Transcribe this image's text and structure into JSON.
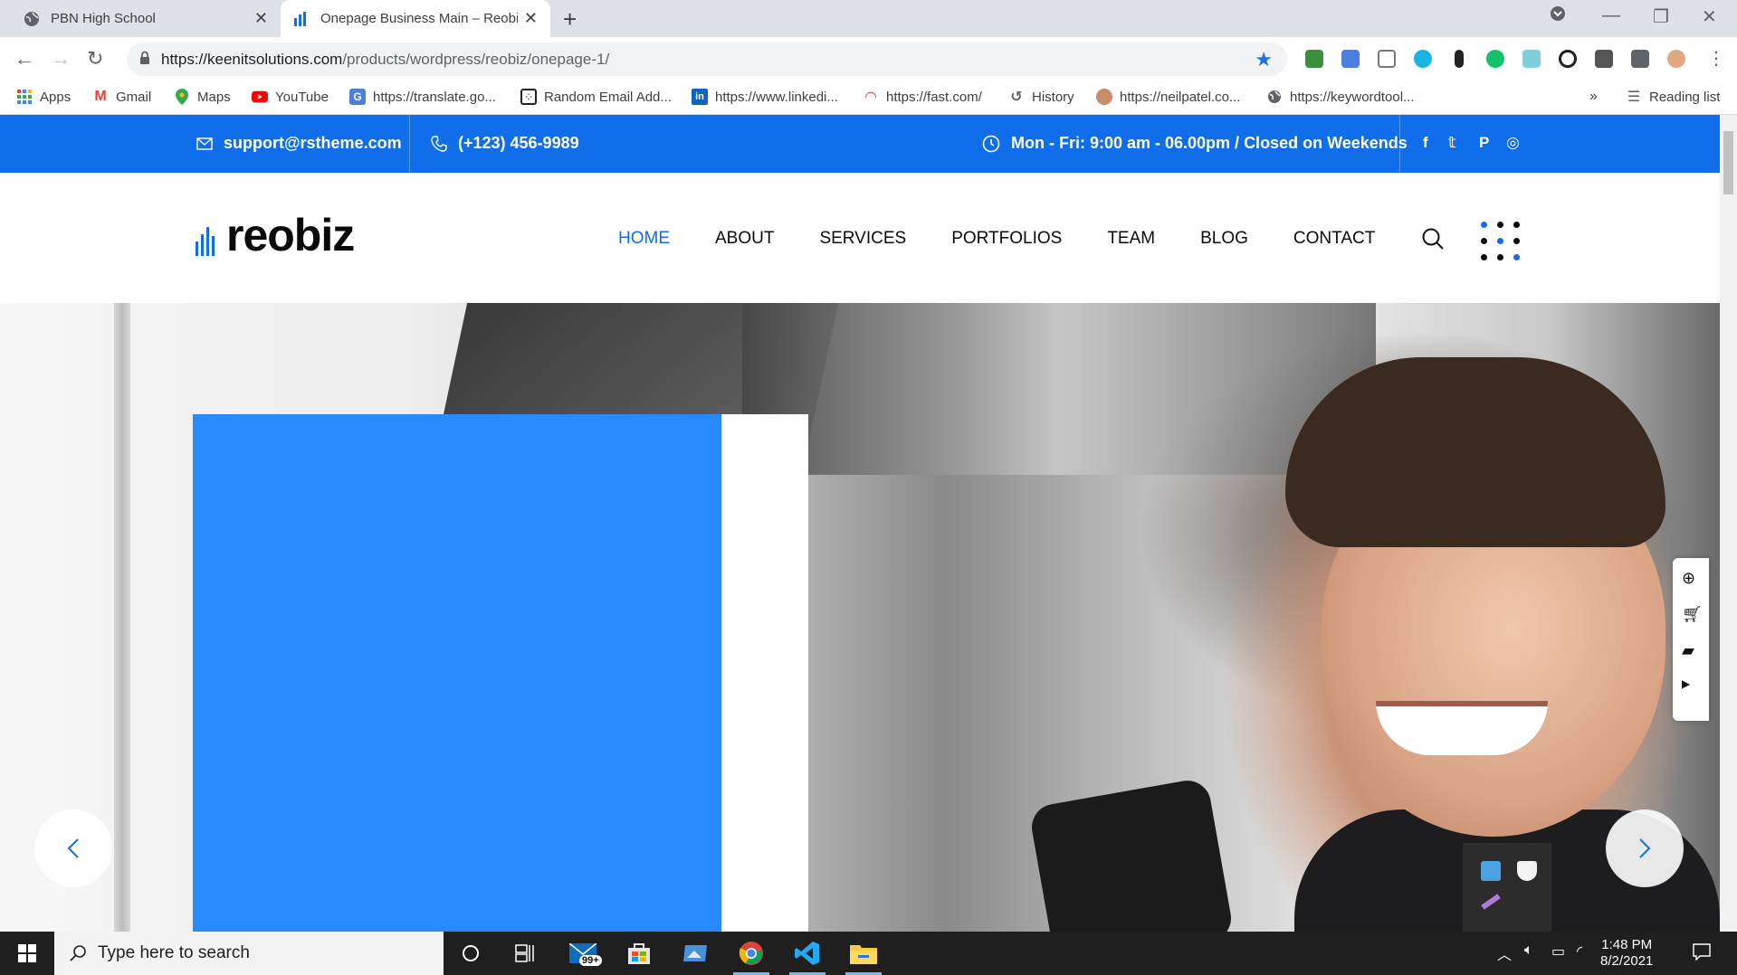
{
  "browser": {
    "tabs": [
      {
        "title": "PBN High School"
      },
      {
        "title": "Onepage Business Main – Reobiz"
      }
    ],
    "url_host": "https://keenitsolutions.com",
    "url_path": "/products/wordpress/reobiz/onepage-1/",
    "bookmarks": [
      {
        "label": "Apps",
        "icon": "apps-grid-icon"
      },
      {
        "label": "Gmail",
        "icon": "gmail-icon"
      },
      {
        "label": "Maps",
        "icon": "maps-pin-icon"
      },
      {
        "label": "YouTube",
        "icon": "youtube-icon"
      },
      {
        "label": "https://translate.go...",
        "icon": "translate-icon"
      },
      {
        "label": "Random Email Add...",
        "icon": "dice-icon"
      },
      {
        "label": "https://www.linkedi...",
        "icon": "linkedin-icon"
      },
      {
        "label": "https://fast.com/",
        "icon": "speedometer-icon"
      },
      {
        "label": "History",
        "icon": "history-icon"
      },
      {
        "label": "https://neilpatel.co...",
        "icon": "avatar-icon"
      },
      {
        "label": "https://keywordtool...",
        "icon": "globe-icon"
      }
    ],
    "overflow": "»",
    "reading_list": "Reading list"
  },
  "site": {
    "topbar": {
      "email": "support@rstheme.com",
      "phone": "(+123) 456-9989",
      "hours": "Mon - Fri: 9:00 am - 06.00pm / Closed on Weekends",
      "social": [
        {
          "label": "f",
          "icon": "facebook-icon"
        },
        {
          "label": "𝕥",
          "icon": "twitter-icon"
        },
        {
          "label": "P",
          "icon": "pinterest-icon"
        },
        {
          "label": "◎",
          "icon": "instagram-icon"
        }
      ]
    },
    "logo": "reobiz",
    "menu": [
      "HOME",
      "ABOUT",
      "SERVICES",
      "PORTFOLIOS",
      "TEAM",
      "BLOG",
      "CONTACT"
    ],
    "active_menu": "HOME",
    "accent": "#106eea",
    "hero_card_color": "#1e85ff"
  },
  "taskbar": {
    "search_placeholder": "Type here to search",
    "mail_badge": "99+",
    "time": "1:48 PM",
    "date": "8/2/2021"
  }
}
